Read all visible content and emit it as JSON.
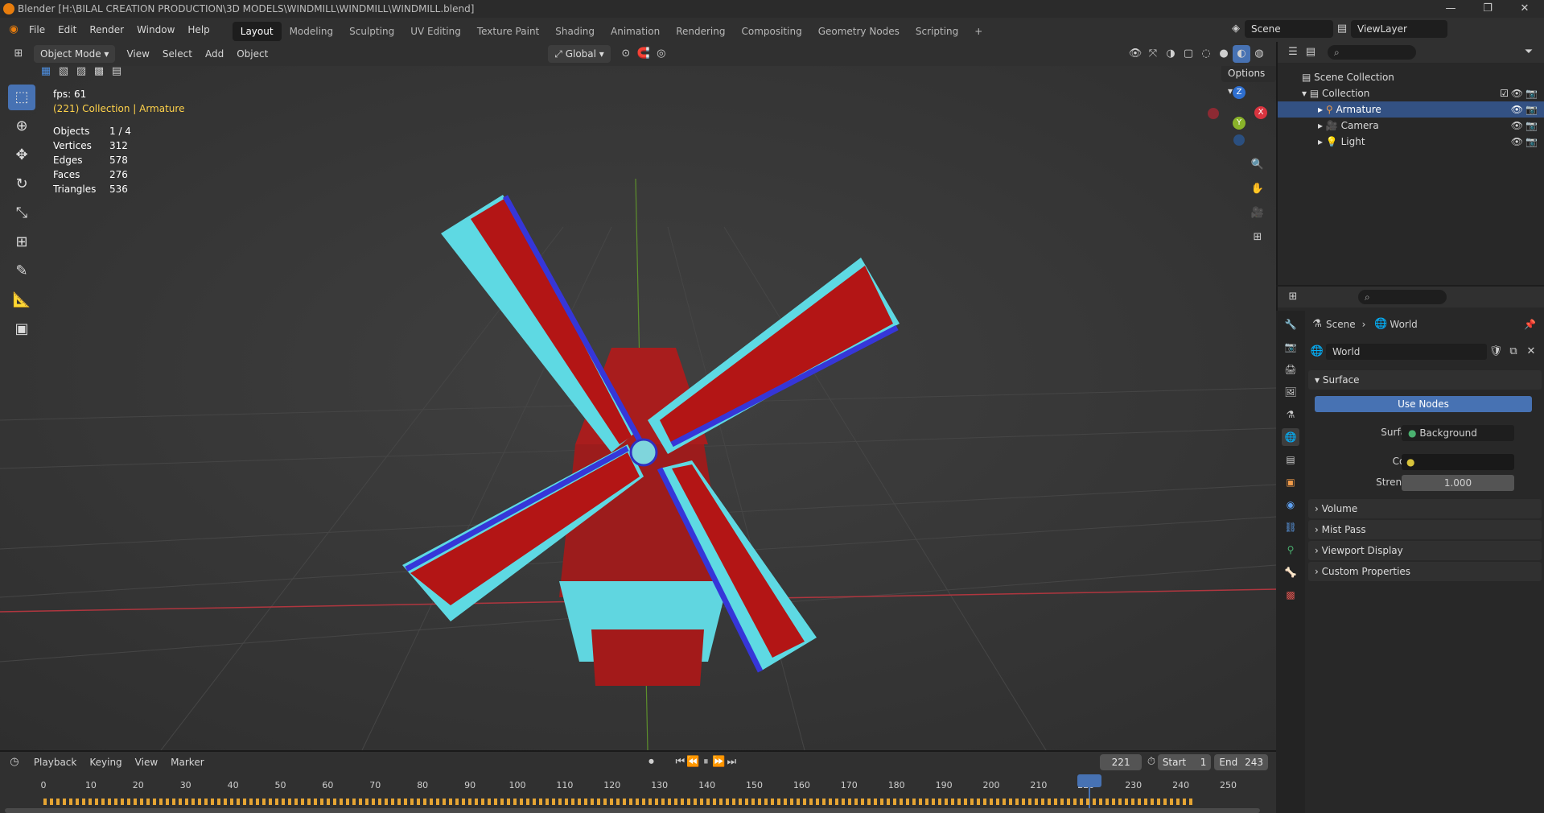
{
  "window": {
    "title": "Blender [H:\\BILAL CREATION PRODUCTION\\3D MODELS\\WINDMILL\\WINDMILL\\WINDMILL.blend]",
    "minimize": "—",
    "maximize": "❐",
    "close": "✕"
  },
  "menu": [
    "File",
    "Edit",
    "Render",
    "Window",
    "Help"
  ],
  "workspaces": [
    "Layout",
    "Modeling",
    "Sculpting",
    "UV Editing",
    "Texture Paint",
    "Shading",
    "Animation",
    "Rendering",
    "Compositing",
    "Geometry Nodes",
    "Scripting",
    "+"
  ],
  "scene": {
    "name": "Scene",
    "view_layer": "ViewLayer"
  },
  "viewport_header": {
    "mode": "Object Mode",
    "menus": [
      "View",
      "Select",
      "Add",
      "Object"
    ],
    "orientation": "Global",
    "options": "Options"
  },
  "overlay": {
    "fps": "fps: 61",
    "context": "(221) Collection | Armature",
    "stats": [
      {
        "k": "Objects",
        "v": "1 / 4"
      },
      {
        "k": "Vertices",
        "v": "312"
      },
      {
        "k": "Edges",
        "v": "578"
      },
      {
        "k": "Faces",
        "v": "276"
      },
      {
        "k": "Triangles",
        "v": "536"
      }
    ]
  },
  "gizmo": {
    "x": "X",
    "y": "Y",
    "z": "Z"
  },
  "outliner": {
    "root": "Scene Collection",
    "collection": "Collection",
    "items": [
      "Armature",
      "Camera",
      "Light"
    ]
  },
  "properties": {
    "breadcrumb_scene": "Scene",
    "breadcrumb_world": "World",
    "world_name": "World",
    "surface_panel": "Surface",
    "use_nodes": "Use Nodes",
    "surface_label": "Surface",
    "surface_value": "Background",
    "color_label": "Color",
    "strength_label": "Strength",
    "strength_value": "1.000",
    "panels": [
      "Volume",
      "Mist Pass",
      "Viewport Display",
      "Custom Properties"
    ]
  },
  "timeline": {
    "menus": [
      "Playback",
      "Keying",
      "View",
      "Marker"
    ],
    "current_frame": "221",
    "start_label": "Start",
    "start_value": "1",
    "end_label": "End",
    "end_value": "243",
    "ticks": [
      "0",
      "10",
      "20",
      "30",
      "40",
      "50",
      "60",
      "70",
      "80",
      "90",
      "100",
      "110",
      "120",
      "130",
      "140",
      "150",
      "160",
      "170",
      "180",
      "190",
      "200",
      "210",
      "220",
      "230",
      "240",
      "250"
    ]
  }
}
